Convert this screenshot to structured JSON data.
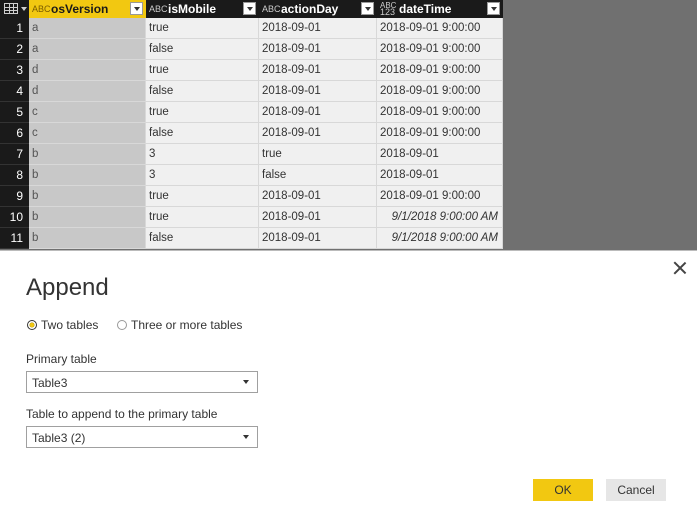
{
  "grid": {
    "columns": [
      {
        "type": "ABC",
        "name": "osVersion",
        "selected": true
      },
      {
        "type": "ABC",
        "name": "isMobile",
        "selected": false
      },
      {
        "type": "ABC",
        "name": "actionDay",
        "selected": false
      },
      {
        "type": "ABC 123",
        "name": "dateTime",
        "selected": false
      }
    ],
    "rows": [
      {
        "num": "1",
        "cells": [
          "a",
          "true",
          "2018-09-01",
          "2018-09-01 9:00:00"
        ],
        "italic_last": false
      },
      {
        "num": "2",
        "cells": [
          "a",
          "false",
          "2018-09-01",
          "2018-09-01 9:00:00"
        ],
        "italic_last": false
      },
      {
        "num": "3",
        "cells": [
          "d",
          "true",
          "2018-09-01",
          "2018-09-01 9:00:00"
        ],
        "italic_last": false
      },
      {
        "num": "4",
        "cells": [
          "d",
          "false",
          "2018-09-01",
          "2018-09-01 9:00:00"
        ],
        "italic_last": false
      },
      {
        "num": "5",
        "cells": [
          "c",
          "true",
          "2018-09-01",
          "2018-09-01 9:00:00"
        ],
        "italic_last": false
      },
      {
        "num": "6",
        "cells": [
          "c",
          "false",
          "2018-09-01",
          "2018-09-01 9:00:00"
        ],
        "italic_last": false
      },
      {
        "num": "7",
        "cells": [
          "b",
          "3",
          "true",
          "2018-09-01"
        ],
        "italic_last": false
      },
      {
        "num": "8",
        "cells": [
          "b",
          "3",
          "false",
          "2018-09-01"
        ],
        "italic_last": false
      },
      {
        "num": "9",
        "cells": [
          "b",
          "true",
          "2018-09-01",
          "2018-09-01 9:00:00"
        ],
        "italic_last": false
      },
      {
        "num": "10",
        "cells": [
          "b",
          "true",
          "2018-09-01",
          "9/1/2018 9:00:00 AM"
        ],
        "italic_last": true
      },
      {
        "num": "11",
        "cells": [
          "b",
          "false",
          "2018-09-01",
          "9/1/2018 9:00:00 AM"
        ],
        "italic_last": true
      }
    ]
  },
  "dialog": {
    "title": "Append",
    "options": {
      "two_tables": "Two tables",
      "three_or_more": "Three or more tables"
    },
    "primary_label": "Primary table",
    "primary_value": "Table3",
    "append_label": "Table to append to the primary table",
    "append_value": "Table3 (2)",
    "ok": "OK",
    "cancel": "Cancel"
  },
  "colors": {
    "accent": "#f2c811",
    "header": "#1a1a1a",
    "backdrop": "#707070"
  }
}
